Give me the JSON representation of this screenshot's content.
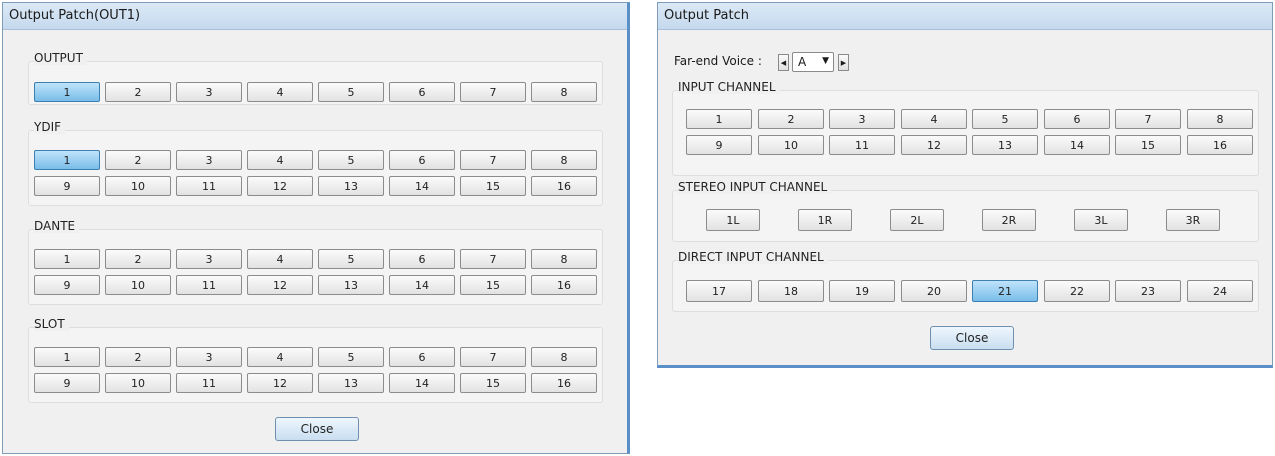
{
  "left_dialog": {
    "title": "Output Patch(OUT1)",
    "groups": [
      {
        "label": "OUTPUT",
        "buttons": [
          "1",
          "2",
          "3",
          "4",
          "5",
          "6",
          "7",
          "8"
        ],
        "selected": "1"
      },
      {
        "label": "YDIF",
        "buttons": [
          "1",
          "2",
          "3",
          "4",
          "5",
          "6",
          "7",
          "8",
          "9",
          "10",
          "11",
          "12",
          "13",
          "14",
          "15",
          "16"
        ],
        "selected": "1"
      },
      {
        "label": "DANTE",
        "buttons": [
          "1",
          "2",
          "3",
          "4",
          "5",
          "6",
          "7",
          "8",
          "9",
          "10",
          "11",
          "12",
          "13",
          "14",
          "15",
          "16"
        ],
        "selected": null
      },
      {
        "label": "SLOT",
        "buttons": [
          "1",
          "2",
          "3",
          "4",
          "5",
          "6",
          "7",
          "8",
          "9",
          "10",
          "11",
          "12",
          "13",
          "14",
          "15",
          "16"
        ],
        "selected": null
      }
    ],
    "close_label": "Close"
  },
  "right_dialog": {
    "title": "Output Patch",
    "far_end": {
      "label": "Far-end Voice :",
      "value": "A",
      "prev_icon": "arrow-left-icon",
      "next_icon": "arrow-right-icon",
      "dropdown_icon": "chevron-down-icon"
    },
    "groups": [
      {
        "label": "INPUT CHANNEL",
        "buttons": [
          "1",
          "2",
          "3",
          "4",
          "5",
          "6",
          "7",
          "8",
          "9",
          "10",
          "11",
          "12",
          "13",
          "14",
          "15",
          "16"
        ],
        "selected": null
      },
      {
        "label": "STEREO INPUT CHANNEL",
        "buttons": [
          "1L",
          "1R",
          "2L",
          "2R",
          "3L",
          "3R"
        ],
        "selected": null
      },
      {
        "label": "DIRECT INPUT CHANNEL",
        "buttons": [
          "17",
          "18",
          "19",
          "20",
          "21",
          "22",
          "23",
          "24"
        ],
        "selected": "21"
      }
    ],
    "close_label": "Close"
  }
}
